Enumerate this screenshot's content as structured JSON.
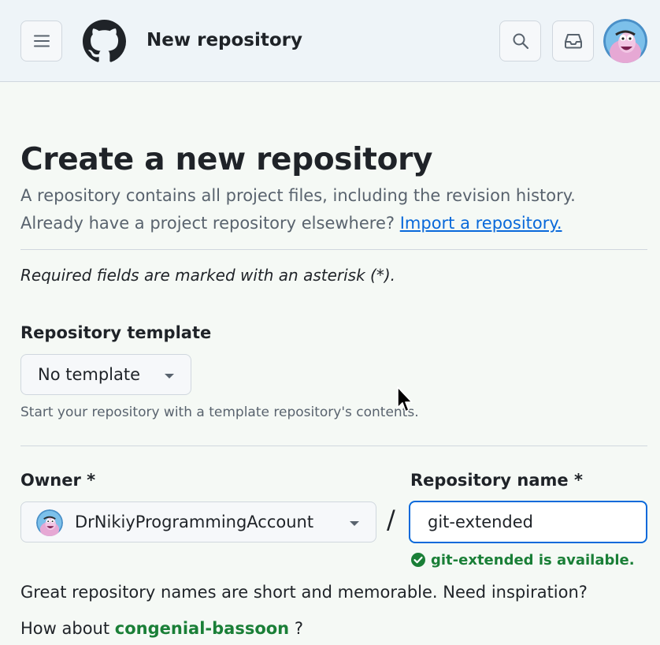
{
  "header": {
    "title": "New repository",
    "icons": [
      "hamburger-menu-icon",
      "github-logo-icon",
      "search-icon",
      "inbox-icon"
    ]
  },
  "main": {
    "title": "Create a new repository",
    "description_line1": "A repository contains all project files, including the revision history.",
    "description_line2_prefix": "Already have a project repository elsewhere?",
    "import_link": "Import a repository.",
    "required_note": "Required fields are marked with an asterisk (*).",
    "template": {
      "label": "Repository template",
      "selected": "No template",
      "hint": "Start your repository with a template repository's contents."
    },
    "owner": {
      "label": "Owner *",
      "selected": "DrNikiyProgrammingAccount"
    },
    "separator": "/",
    "repo_name": {
      "label": "Repository name *",
      "value": "git-extended",
      "availability": "git-extended is available."
    },
    "suggestion_line": "Great repository names are short and memorable. Need inspiration?",
    "suggestion_prefix": "How about",
    "suggestion_name": "congenial-bassoon",
    "suggestion_suffix": "?"
  },
  "colors": {
    "accent_blue": "#0969da",
    "success_green": "#1a7f37",
    "muted_text": "#59636e",
    "border": "#d0d7de"
  }
}
